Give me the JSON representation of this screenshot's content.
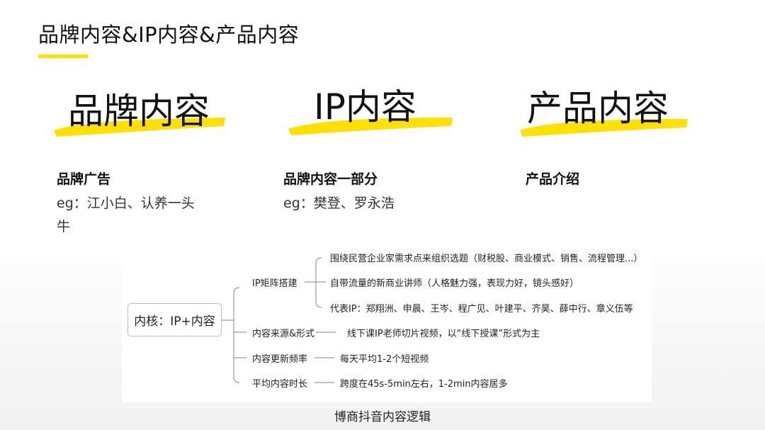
{
  "slide": {
    "title": "品牌内容&IP内容&产品内容",
    "accent_color": "#ffe000"
  },
  "columns": [
    {
      "big_label": "品牌内容",
      "heading": "品牌广告",
      "example_line1": "eg：江小白、认养一头",
      "example_line2": "牛"
    },
    {
      "big_label": "IP内容",
      "heading": "品牌内容一部分",
      "example_line1": "eg：樊登、罗永浩"
    },
    {
      "big_label": "产品内容",
      "heading": "产品介绍"
    }
  ],
  "mindmap": {
    "root": "内核：IP+内容",
    "branch1": {
      "label": "IP矩阵搭建",
      "children": [
        "围绕民营企业家需求点来组织选题（财税股、商业模式、销售、流程管理...）",
        "自带流量的新商业讲师（人格魅力强，表现力好，镜头感好）",
        "代表IP：郑翔洲、申晨、王岑、程广见、叶建平、齐昊、薛中行、章义伍等"
      ]
    },
    "branch2": {
      "label": "内容来源&形式",
      "value": "线下课IP老师切片视频，以“线下授课”形式为主"
    },
    "branch3": {
      "label": "内容更新频率",
      "value": "每天平均1-2个短视频"
    },
    "branch4": {
      "label": "平均内容时长",
      "value": "跨度在45s-5min左右，1-2min内容居多"
    }
  },
  "caption": "博商抖音内容逻辑"
}
